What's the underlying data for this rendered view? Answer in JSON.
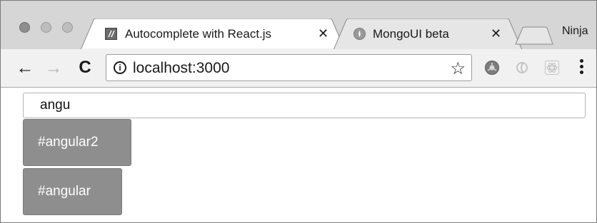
{
  "tabs": [
    {
      "title": "Autocomplete with React.js",
      "close": "✕",
      "favicon": "slash-favicon-icon",
      "active": true
    },
    {
      "title": "MongoUI beta",
      "close": "✕",
      "favicon": "mongoui-favicon-icon",
      "active": false
    }
  ],
  "profile": {
    "name": "Ninja"
  },
  "toolbar": {
    "back": "←",
    "forward": "→",
    "reload": "C",
    "url": "localhost:3000",
    "info_glyph": "i",
    "bookmark": "☆"
  },
  "search": {
    "value": "angu"
  },
  "suggestions": [
    {
      "label": "#angular2"
    },
    {
      "label": "#angular"
    }
  ],
  "colors": {
    "tabstrip": "#d6d6d6",
    "toolbar": "#f1f1f1",
    "suggestion_bg": "#8e8e8e"
  }
}
